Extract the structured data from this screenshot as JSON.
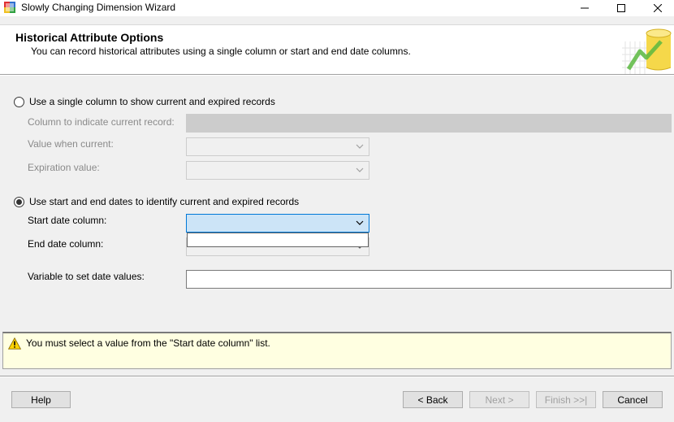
{
  "window": {
    "title": "Slowly Changing Dimension Wizard",
    "icons": {
      "app": "ssis-wizard-icon",
      "minimize": "minimize-icon",
      "maximize": "maximize-icon",
      "close": "close-icon"
    }
  },
  "header": {
    "title": "Historical Attribute Options",
    "description": "You can record historical attributes using a single column or start and end date columns."
  },
  "options": {
    "single_column": {
      "label": "Use a single column to show current and expired records",
      "selected": false,
      "column_label": "Column to indicate current record:",
      "current_label": "Value when current:",
      "expiration_label": "Expiration value:"
    },
    "date_range": {
      "label": "Use start and end dates to identify current and expired records",
      "selected": true,
      "start_label": "Start date column:",
      "start_value": "",
      "end_label": "End date column:",
      "end_value": "",
      "variable_label": "Variable to set date values:",
      "variable_value": ""
    }
  },
  "message": {
    "icon": "warning-icon",
    "text": "You must select a value from the \"Start date column\" list."
  },
  "buttons": {
    "help": "Help",
    "back": "< Back",
    "next": "Next >",
    "finish": "Finish >>|",
    "cancel": "Cancel"
  },
  "colors": {
    "accent": "#0078d7",
    "selection": "#cce4f7",
    "message_bg": "#ffffe1",
    "disabled_text": "#8a8a8a"
  }
}
